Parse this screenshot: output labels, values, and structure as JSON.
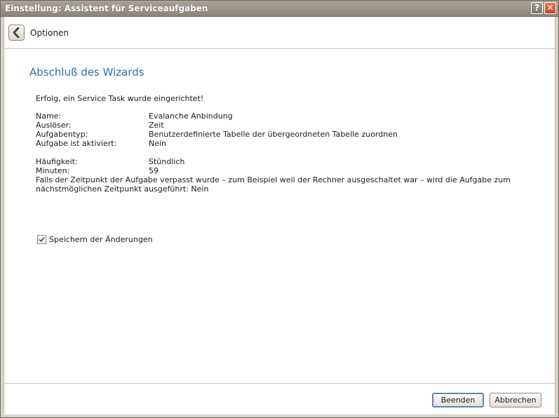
{
  "window": {
    "title": "Einstellung: Assistent für Serviceaufgaben",
    "help_symbol": "?",
    "close_symbol": "✕"
  },
  "nav": {
    "back_icon": "chevron-left-icon",
    "label": "Optionen"
  },
  "wizard": {
    "title": "Abschluß des Wizards",
    "success_message": "Erfolg, ein Service Task wurde eingerichtet!",
    "details": [
      {
        "label": "Name:",
        "value": "Evalanche Anbindung"
      },
      {
        "label": "Auslöser:",
        "value": "Zeit"
      },
      {
        "label": "Aufgabentyp:",
        "value": "Benutzerdefinierte Tabelle der übergeordneten Tabelle zuordnen"
      },
      {
        "label": "Aufgabe ist aktiviert:",
        "value": "Nein"
      }
    ],
    "schedule": [
      {
        "label": "Häufigkeit:",
        "value": "Stündlich"
      },
      {
        "label": "Minuten:",
        "value": "59"
      }
    ],
    "missed_note": "Falls der Zeitpunkt der Aufgabe verpasst wurde – zum Beispiel weil der Rechner ausgeschaltet war – wird die Aufgabe zum nächstmöglichen Zeitpunkt ausgeführt: Nein"
  },
  "save_changes": {
    "label": "Speichern der Änderungen",
    "checked": true
  },
  "footer": {
    "finish_label": "Beenden",
    "cancel_label": "Abbrechen"
  }
}
